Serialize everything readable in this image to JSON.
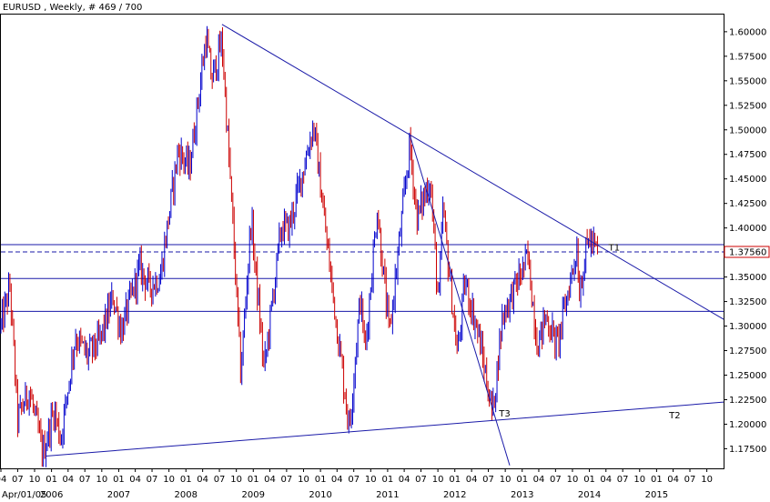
{
  "header": {
    "title": "EURUSD , Weekly, # 469 / 700"
  },
  "colors": {
    "background": "#ffffff",
    "up": "#0000cc",
    "down": "#cc0000",
    "line": "#1a1aa8",
    "frame": "#000000",
    "grid": "#d9d9d9",
    "price_box": "#cc0000"
  },
  "chart_data": {
    "type": "candlestick",
    "symbol": "EURUSD",
    "timeframe": "Weekly",
    "ylim": [
      1.155,
      1.6175
    ],
    "xlim": [
      "2005-04-01",
      "2015-12-31"
    ],
    "y_ticks": [
      "1.17500",
      "1.20000",
      "1.22500",
      "1.25000",
      "1.27500",
      "1.30000",
      "1.32500",
      "1.35000",
      "1.37500",
      "1.40000",
      "1.42500",
      "1.45000",
      "1.47500",
      "1.50000",
      "1.52500",
      "1.55000",
      "1.57500",
      "1.60000"
    ],
    "current_price": "1.37560",
    "x_month_ticks": [
      "04",
      "07",
      "10",
      "01",
      "04",
      "07",
      "10",
      "01",
      "04",
      "07",
      "10",
      "01",
      "04",
      "07",
      "10",
      "01",
      "04",
      "07",
      "10",
      "01",
      "04",
      "07",
      "10",
      "01",
      "04",
      "07",
      "10",
      "01",
      "04",
      "07",
      "10",
      "01",
      "04",
      "07",
      "10",
      "01",
      "04",
      "07",
      "10",
      "01",
      "04",
      "07",
      "10"
    ],
    "x_year_labels": [
      "Apr/01/05",
      "2006",
      "2007",
      "2008",
      "2009",
      "2010",
      "2011",
      "2012",
      "2013",
      "2014",
      "2015"
    ],
    "price_path": [
      [
        "2005-04-01",
        1.3
      ],
      [
        "2005-05-20",
        1.34
      ],
      [
        "2005-07-01",
        1.205
      ],
      [
        "2005-09-01",
        1.235
      ],
      [
        "2005-11-15",
        1.17
      ],
      [
        "2006-01-15",
        1.215
      ],
      [
        "2006-02-20",
        1.185
      ],
      [
        "2006-05-10",
        1.29
      ],
      [
        "2006-07-15",
        1.27
      ],
      [
        "2006-09-20",
        1.285
      ],
      [
        "2006-12-01",
        1.33
      ],
      [
        "2007-01-15",
        1.295
      ],
      [
        "2007-04-25",
        1.36
      ],
      [
        "2007-06-15",
        1.34
      ],
      [
        "2007-08-15",
        1.35
      ],
      [
        "2007-11-20",
        1.48
      ],
      [
        "2008-01-20",
        1.46
      ],
      [
        "2008-04-20",
        1.595
      ],
      [
        "2008-05-20",
        1.55
      ],
      [
        "2008-07-15",
        1.59
      ],
      [
        "2008-09-10",
        1.41
      ],
      [
        "2008-10-25",
        1.25
      ],
      [
        "2008-12-20",
        1.41
      ],
      [
        "2009-03-01",
        1.255
      ],
      [
        "2009-06-01",
        1.4
      ],
      [
        "2009-07-15",
        1.4
      ],
      [
        "2009-11-25",
        1.505
      ],
      [
        "2010-02-20",
        1.36
      ],
      [
        "2010-06-07",
        1.195
      ],
      [
        "2010-08-05",
        1.33
      ],
      [
        "2010-09-01",
        1.275
      ],
      [
        "2010-11-05",
        1.42
      ],
      [
        "2011-01-10",
        1.29
      ],
      [
        "2011-05-01",
        1.485
      ],
      [
        "2011-06-10",
        1.41
      ],
      [
        "2011-08-20",
        1.45
      ],
      [
        "2011-10-05",
        1.32
      ],
      [
        "2011-10-28",
        1.42
      ],
      [
        "2012-01-15",
        1.27
      ],
      [
        "2012-02-25",
        1.345
      ],
      [
        "2012-05-10",
        1.29
      ],
      [
        "2012-07-24",
        1.21
      ],
      [
        "2012-09-15",
        1.31
      ],
      [
        "2013-02-01",
        1.37
      ],
      [
        "2013-03-25",
        1.28
      ],
      [
        "2013-05-10",
        1.31
      ],
      [
        "2013-07-10",
        1.28
      ],
      [
        "2013-10-25",
        1.38
      ],
      [
        "2013-11-07",
        1.335
      ],
      [
        "2013-12-27",
        1.39
      ],
      [
        "2014-02-14",
        1.375
      ]
    ],
    "horizontal_lines": [
      1.315,
      1.3485,
      1.383
    ],
    "dashed_line": 1.3756,
    "trendlines": [
      {
        "label": "T1",
        "points": [
          [
            "2008-07-15",
            1.6075
          ],
          [
            "2011-05-01",
            1.495
          ],
          [
            "2015-12-31",
            1.3175
          ]
        ]
      },
      {
        "label": "T2",
        "points": [
          [
            "2005-12-01",
            1.1675
          ],
          [
            "2015-12-31",
            1.2225
          ]
        ]
      },
      {
        "label": "T3",
        "points": [
          [
            "2011-05-01",
            1.495
          ],
          [
            "2012-10-25",
            1.158
          ]
        ]
      }
    ]
  }
}
